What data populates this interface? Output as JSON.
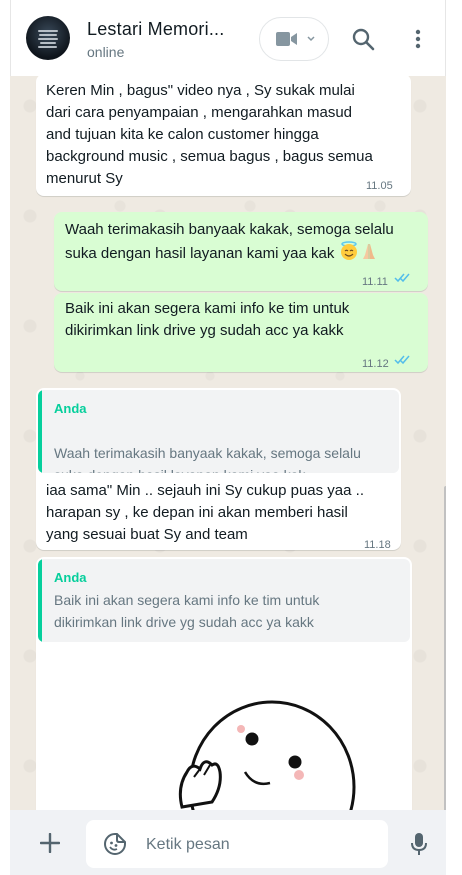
{
  "header": {
    "contact_name": "Lestari Memori...",
    "status": "online"
  },
  "messages": [
    {
      "direction": "incoming",
      "text": "Keren Min , bagus\" video nya , Sy sukak mulai\ndari cara penyampaian , mengarahkan masud\nand tujuan kita ke calon customer hingga\nbackground music , semua bagus , bagus semua\nmenurut Sy",
      "time": "11.05"
    },
    {
      "direction": "outgoing",
      "text": "Waah terimakasih banyaak kakak, semoga selalu\nsuka dengan hasil layanan kami yaa kak",
      "emojis": [
        "smiling-face-with-halo",
        "folded-hands"
      ],
      "time": "11.11",
      "status": "read"
    },
    {
      "direction": "outgoing",
      "text": "Baik ini akan segera kami info ke tim untuk\ndikirimkan link drive yg sudah acc ya kakk",
      "time": "11.12",
      "status": "read"
    },
    {
      "direction": "incoming",
      "quote": {
        "author": "Anda",
        "text": "Waah terimakasih banyaak kakak, semoga selalu\nsuka dengan hasil layanan kami yaa kak"
      },
      "text": "iaa sama\" Min .. sejauh ini Sy cukup puas yaa ..\nharapan sy , ke depan ini akan memberi hasil\nyang sesuai buat Sy and team",
      "time": "11.18"
    },
    {
      "direction": "incoming",
      "quote": {
        "author": "Anda",
        "text": "Baik ini akan segera kami info ke tim untuk\ndikirimkan link drive yg sudah acc ya kakk"
      },
      "sticker": "peeking-cartoon-character"
    }
  ],
  "composer": {
    "placeholder": "Ketik pesan"
  },
  "colors": {
    "outgoing_bubble": "#d9fdd3",
    "incoming_bubble": "#ffffff",
    "chat_background": "#efeae2",
    "accent_green": "#06cf9c",
    "read_ticks": "#53bdeb"
  },
  "icons": [
    "video-call-icon",
    "chevron-down-icon",
    "search-icon",
    "menu-icon",
    "plus-icon",
    "sticker-icon",
    "mic-icon",
    "read-ticks-icon"
  ]
}
